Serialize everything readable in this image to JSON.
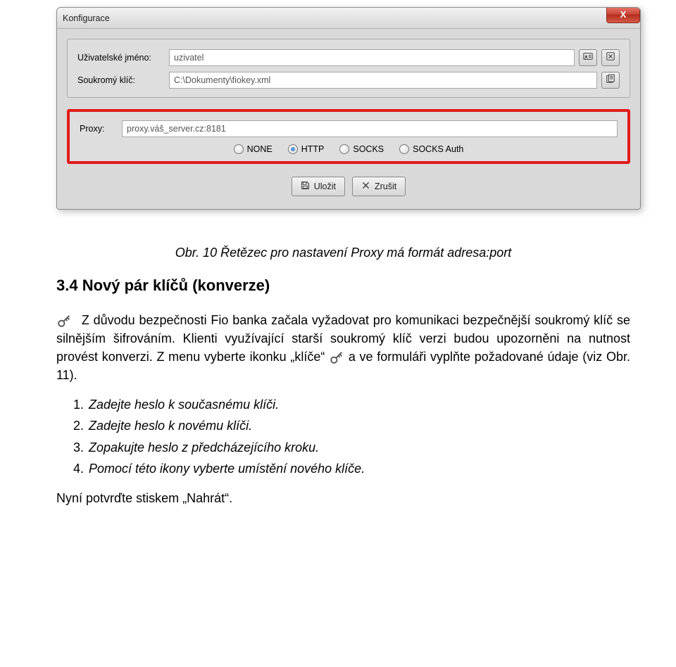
{
  "window": {
    "title": "Konfigurace",
    "close_label": "X",
    "username_label": "Uživatelské jméno:",
    "username_value": "uzivatel",
    "key_label": "Soukromý klíč:",
    "key_value": "C:\\Dokumenty\\fiokey.xml",
    "proxy_label": "Proxy:",
    "proxy_value": "proxy.váš_server.cz:8181",
    "radios": [
      "NONE",
      "HTTP",
      "SOCKS",
      "SOCKS Auth"
    ],
    "radio_selected_index": 1,
    "save_label": "Uložit",
    "cancel_label": "Zrušit"
  },
  "doc": {
    "caption": "Obr. 10 Řetězec pro nastavení Proxy má formát adresa:port",
    "heading": "3.4 Nový pár klíčů (konverze)",
    "p1a": "Z důvodu bezpečnosti Fio banka začala vyžadovat pro komunikaci bezpečnější soukromý klíč se silnějším šifrováním. Klienti využívající starší soukromý klíč verzi budou upozorněni na nutnost provést konverzi. Z menu vyberte ikonku „klíče“ ",
    "p1b": " a ve formuláři vyplňte požadované údaje (viz Obr. 11).",
    "steps": [
      "Zadejte heslo k současnému klíči.",
      "Zadejte heslo k novému klíči.",
      "Zopakujte heslo z předcházejícího kroku.",
      "Pomocí této ikony vyberte umístění nového klíče."
    ],
    "closing": "Nyní potvrďte stiskem „Nahrát“."
  }
}
